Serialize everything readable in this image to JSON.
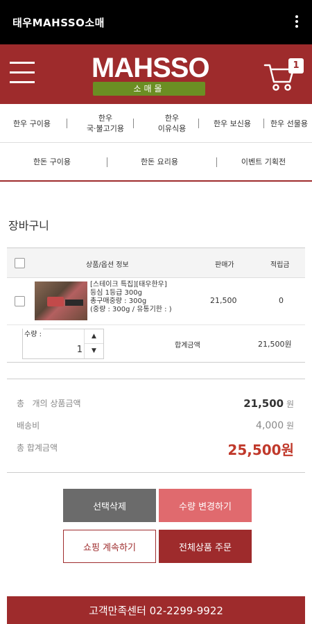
{
  "status_bar": {
    "app_title": "태우MAHSSO소매"
  },
  "header": {
    "logo_text": "MAHSSO",
    "logo_subtitle": "소매몰",
    "cart_count": "1"
  },
  "nav_primary": [
    {
      "label": "한우 구이용"
    },
    {
      "label": "한우\n국·불고기용"
    },
    {
      "label": "한우\n이유식용"
    },
    {
      "label": "한우 보신용"
    },
    {
      "label": "한우 선물용"
    }
  ],
  "nav_secondary": [
    {
      "label": "한돈 구이용"
    },
    {
      "label": "한돈 요리용"
    },
    {
      "label": "이벤트 기획전"
    }
  ],
  "page_title": "장바구니",
  "table": {
    "headers": {
      "product": "상품/옵션 정보",
      "price": "판매가",
      "points": "적립금"
    },
    "item": {
      "name": "[스테이크 특집][태우한우]\n등심 1등급 300g\n총구매중량 : 300g\n(중량 : 300g / 유통기한 : )",
      "price": "21,500",
      "points": "0"
    },
    "quantity_label": "수량 :",
    "quantity_value": "1",
    "subtotal_label": "합계금액",
    "subtotal_value": "21,500원"
  },
  "summary": {
    "goods_label": "총   개의 상품금액",
    "goods_value": "21,500",
    "goods_unit": "원",
    "shipping_label": "배송비",
    "shipping_value": "4,000",
    "shipping_unit": "원",
    "total_label": "총 합계금액",
    "total_value": "25,500원"
  },
  "buttons": {
    "delete_selected": "선택삭제",
    "change_quantity": "수량 변경하기",
    "continue_shopping": "쇼핑 계속하기",
    "order_all": "전체상품 주문"
  },
  "footer": {
    "customer_center": "고객만족센터 02-2299-9922"
  },
  "colors": {
    "brand": "#9e2b2c",
    "accent_green": "#6b8e23",
    "total_red": "#c0392b"
  }
}
